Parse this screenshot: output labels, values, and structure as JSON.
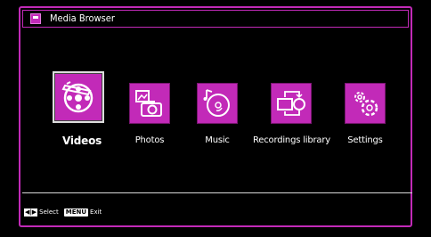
{
  "window": {
    "title": "Media Browser"
  },
  "menu": {
    "items": [
      {
        "id": "videos",
        "label": "Videos",
        "icon": "film-reel-icon",
        "selected": true
      },
      {
        "id": "photos",
        "label": "Photos",
        "icon": "camera-photo-icon",
        "selected": false
      },
      {
        "id": "music",
        "label": "Music",
        "icon": "music-disc-icon",
        "selected": false
      },
      {
        "id": "recordings",
        "label": "Recordings library",
        "icon": "recordings-icon",
        "selected": false
      },
      {
        "id": "settings",
        "label": "Settings",
        "icon": "gears-icon",
        "selected": false
      }
    ]
  },
  "footer": {
    "select_key": "◀|▶",
    "select_label": "Select",
    "menu_key": "MENU",
    "exit_label": "Exit"
  },
  "colors": {
    "accent": "#c22ab8",
    "background": "#000000",
    "text": "#ffffff"
  }
}
